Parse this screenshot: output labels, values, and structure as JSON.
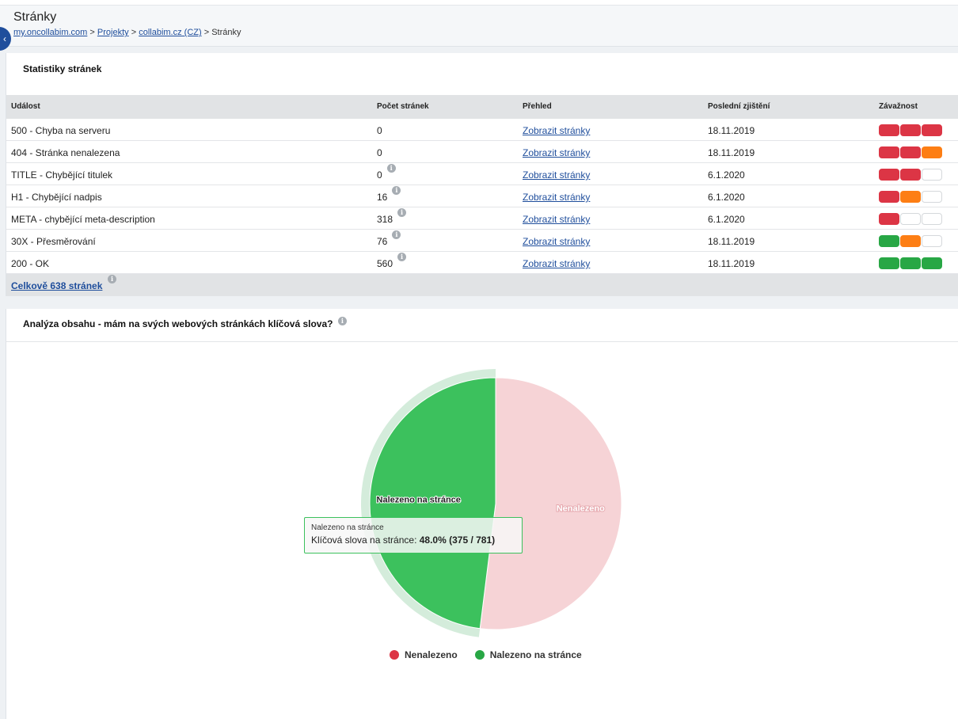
{
  "header": {
    "title": "Stránky",
    "breadcrumb": [
      "my.oncollabim.com",
      "Projekty",
      "collabim.cz (CZ)",
      "Stránky"
    ],
    "separator": ">"
  },
  "stats": {
    "title": "Statistiky stránek",
    "columns": [
      "Událost",
      "Počet stránek",
      "Přehled",
      "Poslední zjištění",
      "Závažnost"
    ],
    "rows": [
      {
        "event": "500 - Chyba na serveru",
        "count": "0",
        "info": false,
        "link": "Zobrazit stránky",
        "date": "18.11.2019",
        "severity": [
          "red",
          "red",
          "red"
        ]
      },
      {
        "event": "404 - Stránka nenalezena",
        "count": "0",
        "info": false,
        "link": "Zobrazit stránky",
        "date": "18.11.2019",
        "severity": [
          "red",
          "red",
          "orange"
        ]
      },
      {
        "event": "TITLE - Chybějící titulek",
        "count": "0",
        "info": true,
        "link": "Zobrazit stránky",
        "date": "6.1.2020",
        "severity": [
          "red",
          "red",
          "empty"
        ]
      },
      {
        "event": "H1 - Chybějící nadpis",
        "count": "16",
        "info": true,
        "link": "Zobrazit stránky",
        "date": "6.1.2020",
        "severity": [
          "red",
          "orange",
          "empty"
        ]
      },
      {
        "event": "META - chybějící meta-description",
        "count": "318",
        "info": true,
        "link": "Zobrazit stránky",
        "date": "6.1.2020",
        "severity": [
          "red",
          "empty",
          "empty"
        ]
      },
      {
        "event": "30X - Přesměrování",
        "count": "76",
        "info": true,
        "link": "Zobrazit stránky",
        "date": "18.11.2019",
        "severity": [
          "green",
          "orange",
          "empty"
        ]
      },
      {
        "event": "200 - OK",
        "count": "560",
        "info": true,
        "link": "Zobrazit stránky",
        "date": "18.11.2019",
        "severity": [
          "green",
          "green",
          "green"
        ]
      }
    ],
    "total_label": "Celkově 638 stránek"
  },
  "analysis": {
    "title": "Analýza obsahu - mám na svých webových stránkách klíčová slova?"
  },
  "chart_data": {
    "type": "pie",
    "slices": [
      {
        "name": "Nenalezeno",
        "value": 406,
        "percent": 52.0,
        "color": "#dc3545"
      },
      {
        "name": "Nalezeno na stránce",
        "value": 375,
        "percent": 48.0,
        "color": "#28a745"
      }
    ],
    "legend": [
      "Nenalezeno",
      "Nalezeno na stránce"
    ],
    "legend_position": "bottom",
    "highlighted": "Nalezeno na stránce",
    "tooltip": {
      "title": "Nalezeno na stránce",
      "label": "Klíčová slova na stránce:",
      "value": "48.0% (375 / 781)"
    }
  },
  "colors": {
    "link": "#1f4e9c",
    "found": "#3cc15d",
    "found_dimmed": "#d4ecdb",
    "not_found": "#dc3545",
    "not_found_dimmed": "#f6d3d6"
  }
}
